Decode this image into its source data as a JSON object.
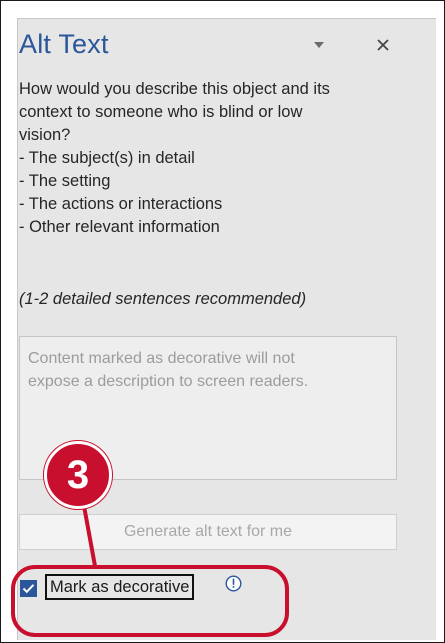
{
  "pane": {
    "title": "Alt Text",
    "header_icons": [
      "chevron-down-icon",
      "close-icon"
    ],
    "close_glyph": "✕",
    "description_lines": [
      "How would you describe this object and its",
      "context to someone who is blind or low",
      "vision?",
      "- The subject(s) in detail",
      "- The setting",
      "- The actions or interactions",
      "- Other relevant information"
    ],
    "recommendation": "(1-2 detailed sentences recommended)",
    "textarea_lines": [
      "Content marked as decorative will not",
      "expose a description to screen readers."
    ],
    "generate_button_label": "Generate alt text for me",
    "decorative_checkbox": {
      "label": "Mark as decorative",
      "checked": true
    }
  },
  "annotation": {
    "step_number": "3",
    "color": "#c8102e"
  },
  "colors": {
    "accent": "#2b579a",
    "pane_background": "#e6e6e6",
    "annotation_red": "#c8102e"
  }
}
